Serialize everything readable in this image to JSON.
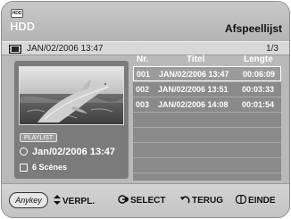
{
  "header": {
    "badge": "HDD",
    "mode": "HDD",
    "menu_title": "Afspeellijst"
  },
  "infobar": {
    "date": "JAN/02/2006 13:47",
    "page": "1/3"
  },
  "left_panel": {
    "playlist_tag": "PLAYLIST",
    "selected_date": "Jan/02/2006 13:47",
    "scene_count": "6 Scènes"
  },
  "table": {
    "headers": {
      "nr": "Nr.",
      "titel": "Titel",
      "lengte": "Lengte"
    },
    "rows": [
      {
        "nr": "001",
        "titel": "JAN/02/2006 13:47",
        "lengte": "00:06:09",
        "selected": true
      },
      {
        "nr": "002",
        "titel": "JAN/02/2006 13:51",
        "lengte": "00:03:33"
      },
      {
        "nr": "003",
        "titel": "JAN/02/2006 14:08",
        "lengte": "00:01:54"
      }
    ],
    "empty_rows": 5
  },
  "footer": {
    "anykey": "Anykey",
    "verpl": "VERPL.",
    "select": "SELECT",
    "terug": "TERUG",
    "einde": "EINDE"
  },
  "icons": {
    "hdd": "hdd-icon",
    "film": "film-icon",
    "clock": "clock-icon",
    "scenes": "scenes-icon",
    "updown": "up-down-arrows-icon",
    "enter": "enter-icon",
    "return": "return-icon",
    "exit": "exit-icon"
  },
  "colors": {
    "background": "#b9b9b9",
    "panel": "#7b7b7b",
    "row": "#8a8a8a",
    "text_light": "#ffffff",
    "text_dark": "#111111"
  }
}
